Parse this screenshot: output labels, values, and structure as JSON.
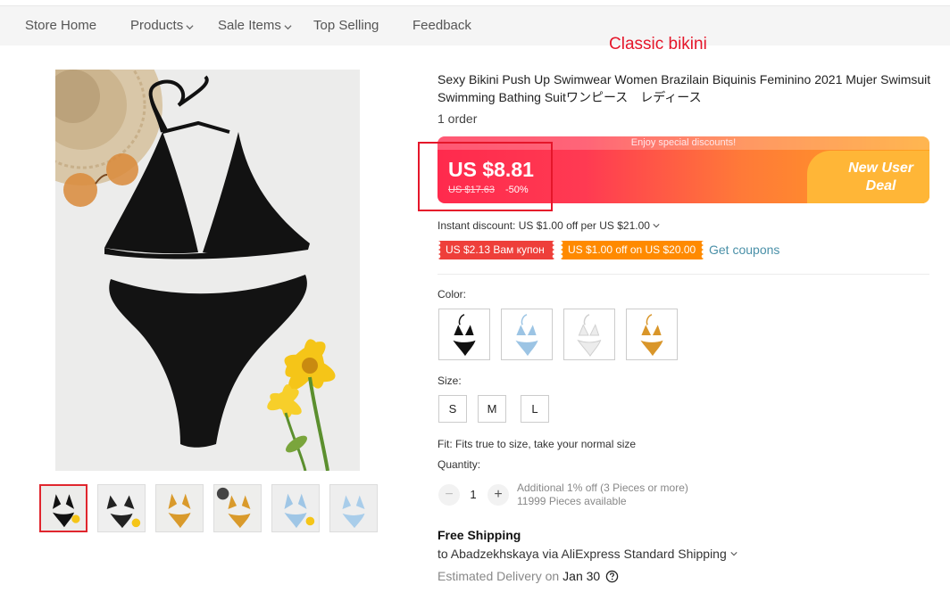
{
  "nav": {
    "items": [
      {
        "label": "Store Home",
        "dropdown": false
      },
      {
        "label": "Products",
        "dropdown": true
      },
      {
        "label": "Sale Items",
        "dropdown": true
      },
      {
        "label": "Top Selling",
        "dropdown": false
      },
      {
        "label": "Feedback",
        "dropdown": false
      }
    ]
  },
  "annotation": {
    "text": "Classic bikini",
    "color": "#e5162a"
  },
  "product": {
    "title": "Sexy Bikini Push Up Swimwear Women Brazilain Biquinis Feminino 2021 Mujer Swimsuit Swimming Bathing Suitワンピース　レディース",
    "orders": "1 order"
  },
  "gallery": {
    "selected_index": 0,
    "thumbnails": [
      "black",
      "black-white",
      "mustard",
      "mustard",
      "light-blue",
      "light-blue"
    ]
  },
  "price": {
    "banner_top": "Enjoy special discounts!",
    "current": "US $8.81",
    "original": "US $17.63",
    "discount": "-50%",
    "new_user_line1": "New User",
    "new_user_line2": "Deal"
  },
  "instant_discount": "Instant discount: US $1.00 off per US $21.00",
  "coupons": {
    "items": [
      "US $2.13 Вам купон",
      "US $1.00 off on US $20.00"
    ],
    "get_label": "Get coupons"
  },
  "color": {
    "label": "Color:",
    "options": [
      "black",
      "light-blue",
      "white",
      "mustard"
    ]
  },
  "size": {
    "label": "Size:",
    "options": [
      "S",
      "M",
      "L"
    ]
  },
  "fit": "Fit: Fits true to size, take your normal size",
  "quantity": {
    "label": "Quantity:",
    "minus": "−",
    "plus": "+",
    "value": "1",
    "info_line1": "Additional 1% off (3 Pieces or more)",
    "info_line2": "11999 Pieces available"
  },
  "shipping": {
    "heading": "Free Shipping",
    "to": "to Abadzekhskaya via AliExpress Standard Shipping",
    "estimated_label": "Estimated Delivery on",
    "estimated_date": "Jan 30"
  },
  "colors": {
    "accent_red": "#e5162a",
    "banner_start": "#ff2a4d",
    "banner_end": "#ffa21f",
    "coupon_red": "#ee3f3a",
    "coupon_orange": "#ff8a00",
    "link_blue": "#4a90a8"
  }
}
